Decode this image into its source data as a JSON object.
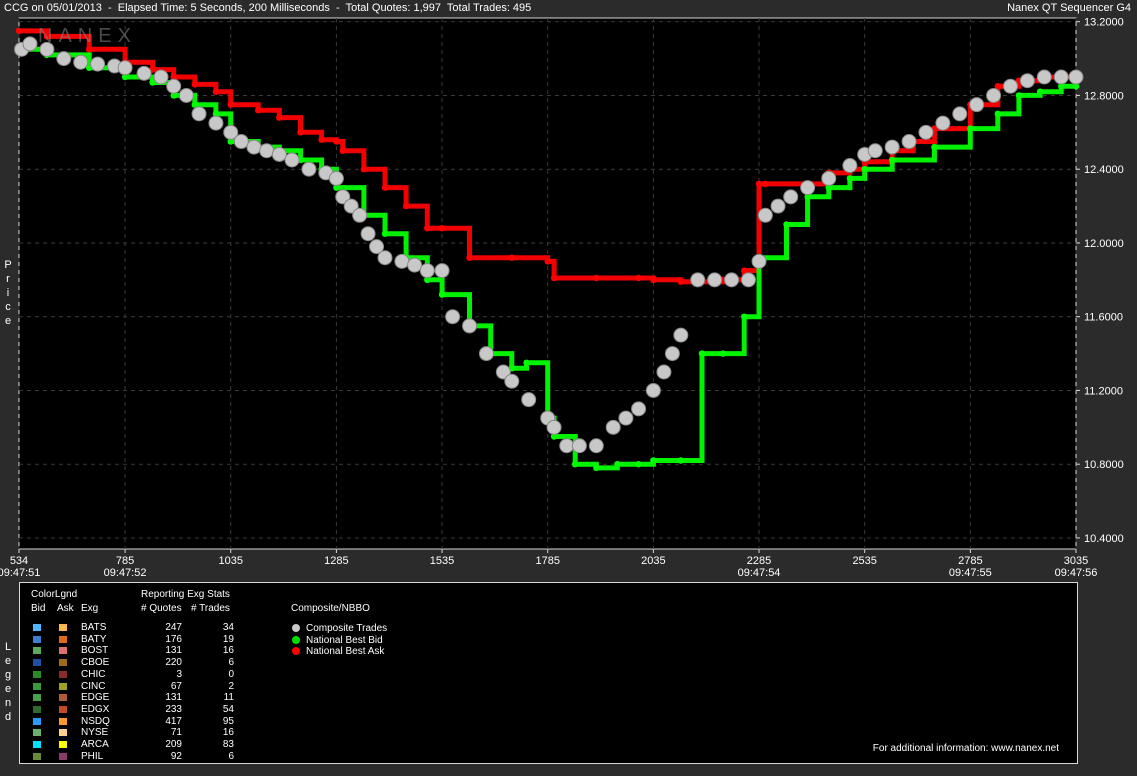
{
  "header": {
    "left": "CCG on 05/01/2013  -  Elapsed Time: 5 Seconds, 200 Milliseconds  -  Total Quotes: 1,997  Total Trades: 495",
    "right": "Nanex QT Sequencer G4",
    "watermark": "NANEX"
  },
  "side_labels": {
    "price": "Price",
    "legend": "Legend"
  },
  "chart_data": {
    "type": "line",
    "xlim": [
      534,
      3035
    ],
    "ylim": [
      10.34,
      13.22
    ],
    "x_ticks": [
      534,
      785,
      1035,
      1285,
      1535,
      1785,
      2035,
      2285,
      2535,
      2785,
      3035
    ],
    "time_ticks": [
      {
        "x": 534,
        "label": "09:47:51"
      },
      {
        "x": 785,
        "label": "09:47:52"
      },
      {
        "x": 2285,
        "label": "09:47:54"
      },
      {
        "x": 2785,
        "label": "09:47:55"
      },
      {
        "x": 3035,
        "label": "09:47:56"
      }
    ],
    "y_ticks": [
      "10.4000",
      "10.8000",
      "11.2000",
      "11.6000",
      "12.0000",
      "12.4000",
      "12.8000",
      "13.2000"
    ],
    "grid": true,
    "series": [
      {
        "name": "National Best Ask",
        "color": "#ff0000",
        "x": [
          534,
          600,
          700,
          785,
          850,
          900,
          950,
          1000,
          1035,
          1100,
          1150,
          1200,
          1250,
          1285,
          1300,
          1350,
          1400,
          1450,
          1500,
          1535,
          1600,
          1700,
          1785,
          1800,
          1900,
          2000,
          2035,
          2100,
          2150,
          2200,
          2250,
          2285,
          2300,
          2400,
          2450,
          2500,
          2535,
          2600,
          2650,
          2700,
          2785,
          2850,
          2900,
          2950,
          3000,
          3035
        ],
        "y": [
          13.15,
          13.12,
          13.05,
          12.98,
          12.94,
          12.9,
          12.86,
          12.82,
          12.75,
          12.72,
          12.68,
          12.6,
          12.56,
          12.55,
          12.5,
          12.4,
          12.3,
          12.2,
          12.08,
          12.08,
          11.92,
          11.92,
          11.9,
          11.81,
          11.81,
          11.81,
          11.8,
          11.79,
          11.79,
          11.8,
          11.85,
          12.32,
          12.32,
          12.32,
          12.38,
          12.4,
          12.44,
          12.5,
          12.55,
          12.62,
          12.75,
          12.85,
          12.88,
          12.9,
          12.9,
          12.9
        ]
      },
      {
        "name": "National Best Bid",
        "color": "#00ff00",
        "x": [
          534,
          600,
          700,
          785,
          850,
          900,
          950,
          1000,
          1035,
          1100,
          1150,
          1200,
          1250,
          1285,
          1350,
          1400,
          1450,
          1500,
          1535,
          1600,
          1650,
          1700,
          1735,
          1785,
          1800,
          1850,
          1900,
          1950,
          2000,
          2035,
          2100,
          2150,
          2200,
          2250,
          2285,
          2350,
          2400,
          2450,
          2500,
          2535,
          2600,
          2700,
          2785,
          2850,
          2900,
          2950,
          3000,
          3035
        ],
        "y": [
          13.05,
          13.02,
          12.95,
          12.9,
          12.87,
          12.8,
          12.75,
          12.7,
          12.55,
          12.52,
          12.5,
          12.45,
          12.4,
          12.3,
          12.15,
          12.05,
          11.92,
          11.8,
          11.72,
          11.55,
          11.4,
          11.32,
          11.35,
          11.05,
          10.95,
          10.8,
          10.78,
          10.8,
          10.8,
          10.82,
          10.82,
          11.4,
          11.4,
          11.6,
          11.92,
          12.1,
          12.25,
          12.3,
          12.35,
          12.4,
          12.45,
          12.52,
          12.62,
          12.7,
          12.8,
          12.82,
          12.85,
          12.85
        ]
      },
      {
        "name": "Composite Trades",
        "color": "#c8c8c8",
        "x": [
          540,
          560,
          600,
          640,
          680,
          720,
          760,
          785,
          830,
          870,
          900,
          930,
          960,
          1000,
          1035,
          1060,
          1090,
          1120,
          1150,
          1180,
          1220,
          1260,
          1285,
          1300,
          1320,
          1340,
          1360,
          1380,
          1400,
          1440,
          1470,
          1500,
          1535,
          1560,
          1600,
          1640,
          1680,
          1700,
          1740,
          1785,
          1800,
          1830,
          1860,
          1900,
          1940,
          1970,
          2000,
          2035,
          2060,
          2080,
          2100,
          2140,
          2180,
          2220,
          2260,
          2285,
          2300,
          2330,
          2360,
          2400,
          2450,
          2500,
          2535,
          2560,
          2600,
          2640,
          2680,
          2720,
          2760,
          2800,
          2840,
          2880,
          2920,
          2960,
          3000,
          3035
        ],
        "y": [
          13.05,
          13.08,
          13.05,
          13.0,
          12.98,
          12.97,
          12.96,
          12.95,
          12.92,
          12.9,
          12.85,
          12.8,
          12.7,
          12.65,
          12.6,
          12.55,
          12.52,
          12.5,
          12.48,
          12.45,
          12.4,
          12.38,
          12.35,
          12.25,
          12.2,
          12.15,
          12.05,
          11.98,
          11.92,
          11.9,
          11.88,
          11.85,
          11.85,
          11.6,
          11.55,
          11.4,
          11.3,
          11.25,
          11.15,
          11.05,
          11.0,
          10.9,
          10.9,
          10.9,
          11.0,
          11.05,
          11.1,
          11.2,
          11.3,
          11.4,
          11.5,
          11.8,
          11.8,
          11.8,
          11.8,
          11.9,
          12.15,
          12.2,
          12.25,
          12.3,
          12.35,
          12.42,
          12.48,
          12.5,
          12.52,
          12.55,
          12.6,
          12.65,
          12.7,
          12.75,
          12.8,
          12.85,
          12.88,
          12.9,
          12.9,
          12.9
        ]
      }
    ]
  },
  "legend": {
    "colorlgnd_title": "ColorLgnd",
    "stats_title": "Reporting Exg Stats",
    "col_bid": "Bid",
    "col_ask": "Ask",
    "col_exg": "Exg",
    "col_quotes": "# Quotes",
    "col_trades": "# Trades",
    "composite_title": "Composite/NBBO",
    "rows": [
      {
        "exg": "BATS",
        "quotes": "247",
        "trades": "34",
        "bid": "#4fb6ff",
        "ask": "#ffb84f"
      },
      {
        "exg": "BATY",
        "quotes": "176",
        "trades": "19",
        "bid": "#3a7fd0",
        "ask": "#e06a1a"
      },
      {
        "exg": "BOST",
        "quotes": "131",
        "trades": "16",
        "bid": "#5aaa5a",
        "ask": "#e07070"
      },
      {
        "exg": "CBOE",
        "quotes": "220",
        "trades": "6",
        "bid": "#1f4fa0",
        "ask": "#a06a1a"
      },
      {
        "exg": "CHIC",
        "quotes": "3",
        "trades": "0",
        "bid": "#2a8a2a",
        "ask": "#8a2a2a"
      },
      {
        "exg": "CINC",
        "quotes": "67",
        "trades": "2",
        "bid": "#3a9a3a",
        "ask": "#a0a020"
      },
      {
        "exg": "EDGE",
        "quotes": "131",
        "trades": "11",
        "bid": "#4aa04a",
        "ask": "#b05a3a"
      },
      {
        "exg": "EDGX",
        "quotes": "233",
        "trades": "54",
        "bid": "#2f6a2f",
        "ask": "#c04a2a"
      },
      {
        "exg": "NSDQ",
        "quotes": "417",
        "trades": "95",
        "bid": "#2a9aff",
        "ask": "#ff9a2a"
      },
      {
        "exg": "NYSE",
        "quotes": "71",
        "trades": "16",
        "bid": "#6ab06a",
        "ask": "#ffd08a"
      },
      {
        "exg": "ARCA",
        "quotes": "209",
        "trades": "83",
        "bid": "#00e0ff",
        "ask": "#ffff00"
      },
      {
        "exg": "PHIL",
        "quotes": "92",
        "trades": "6",
        "bid": "#6a8a3a",
        "ask": "#8a3a6a"
      }
    ],
    "composite_items": [
      {
        "label": "Composite Trades",
        "color": "#c8c8c8"
      },
      {
        "label": "National Best Bid",
        "color": "#00e000"
      },
      {
        "label": "National Best Ask",
        "color": "#ff0000"
      }
    ],
    "footer": "For additional information: www.nanex.net"
  }
}
